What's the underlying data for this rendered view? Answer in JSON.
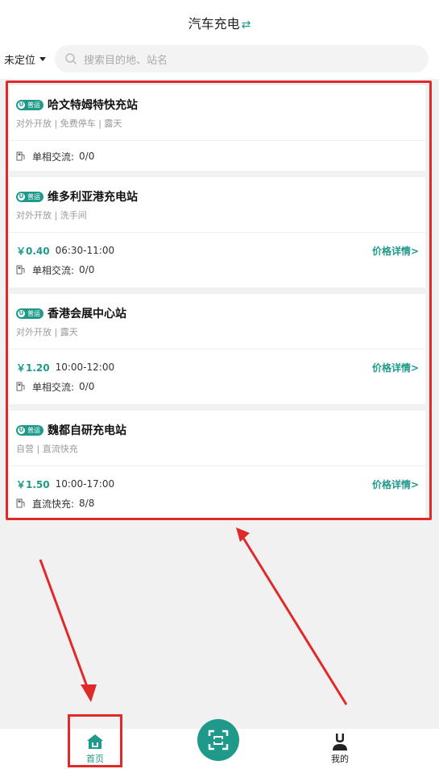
{
  "header": {
    "title": "汽车充电",
    "swap_icon": "swap-arrows-icon"
  },
  "location": {
    "label": "未定位"
  },
  "search": {
    "placeholder": "搜索目的地、站名"
  },
  "tag_label": "普运",
  "stations": [
    {
      "name": "哈文特姆特快充站",
      "attrs": "对外开放 | 免费停车 | 露天",
      "price": null,
      "time": null,
      "detail": null,
      "charge_type": "单相交流:",
      "charge_count": "0/0"
    },
    {
      "name": "维多利亚港充电站",
      "attrs": "对外开放 | 洗手间",
      "price": "￥0.40",
      "time": "06:30-11:00",
      "detail": "价格详情>",
      "charge_type": "单相交流:",
      "charge_count": "0/0"
    },
    {
      "name": "香港会展中心站",
      "attrs": "对外开放 | 露天",
      "price": "￥1.20",
      "time": "10:00-12:00",
      "detail": "价格详情>",
      "charge_type": "单相交流:",
      "charge_count": "0/0"
    },
    {
      "name": "魏都自研充电站",
      "attrs": "自营 | 直流快充",
      "price": "￥1.50",
      "time": "10:00-17:00",
      "detail": "价格详情>",
      "charge_type": "直流快充:",
      "charge_count": "8/8"
    }
  ],
  "tabbar": {
    "home_label": "首页",
    "me_label": "我的"
  },
  "colors": {
    "accent": "#1f9a8a",
    "highlight": "#e02a2a"
  }
}
